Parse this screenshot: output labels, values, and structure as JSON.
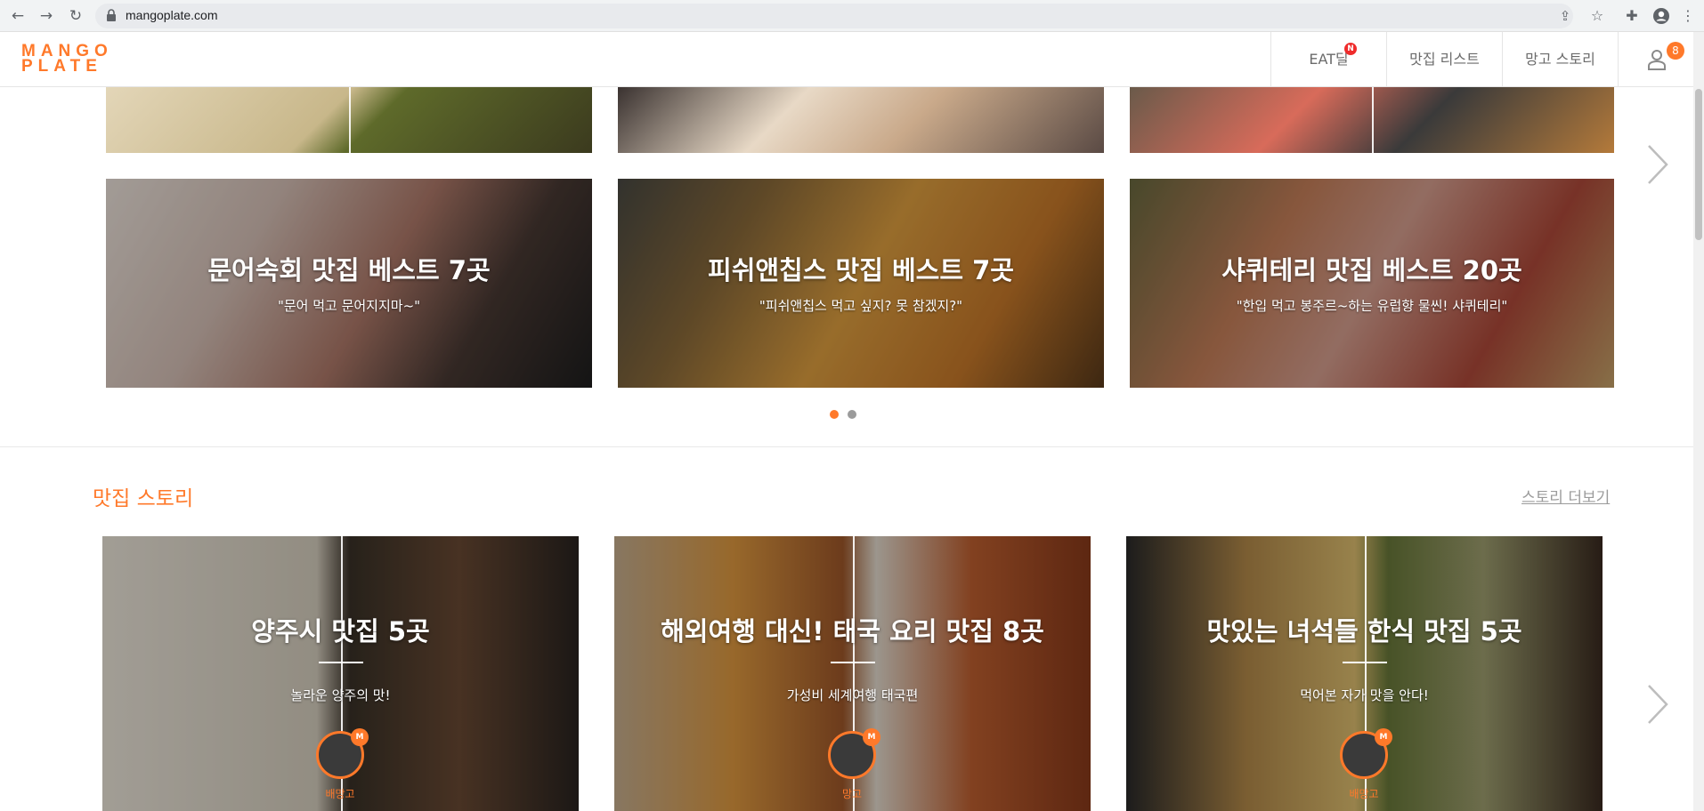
{
  "browser": {
    "url": "mangoplate.com",
    "icons": [
      "back-icon",
      "forward-icon",
      "reload-icon",
      "lock-icon",
      "share-icon",
      "star-icon",
      "extensions-icon",
      "profile-icon",
      "menu-icon"
    ]
  },
  "header": {
    "logo_top": "MANGO",
    "logo_bottom": "PLATE",
    "nav": [
      {
        "label": "EAT딜",
        "badge": "N"
      },
      {
        "label": "맛집 리스트"
      },
      {
        "label": "망고 스토리"
      }
    ],
    "notification_count": "8"
  },
  "top_row": {
    "tiles": [
      {
        "title": "",
        "colors": [
          "#d9c9a8",
          "#7c6a3a"
        ]
      },
      {
        "title": "",
        "colors": [
          "#d4bfa4",
          "#6b5a4a"
        ]
      },
      {
        "title": "",
        "colors": [
          "#c46a5a",
          "#6a4a3a"
        ]
      }
    ]
  },
  "lists": {
    "tiles": [
      {
        "title": "문어숙회 맛집 베스트 7곳",
        "subtitle": "\"문어 먹고 문어지지마~\"",
        "colors": [
          "#e6dcd2",
          "#a8553a"
        ]
      },
      {
        "title": "피쉬앤칩스 맛집 베스트 7곳",
        "subtitle": "\"피쉬앤칩스 먹고 싶지? 못 참겠지?\"",
        "colors": [
          "#d7953a",
          "#7a4a1a"
        ]
      },
      {
        "title": "샤퀴테리 맛집 베스트 20곳",
        "subtitle": "\"한입 먹고 봉주르~하는 유럽향 물씬! 샤퀴테리\"",
        "colors": [
          "#c98a7a",
          "#7a3a2a"
        ]
      }
    ],
    "pager": [
      "active",
      "inactive"
    ]
  },
  "stories": {
    "title": "맛집 스토리",
    "more": "스토리 더보기",
    "cards": [
      {
        "title": "양주시 맛집 5곳",
        "subtitle": "놀라운 양주의 맛!",
        "author": "배망고",
        "colors": [
          "#e8e2d6",
          "#4a3a2a"
        ]
      },
      {
        "title": "해외여행 대신! 태국 요리 맛집 8곳",
        "subtitle": "가성비 세계여행 태국편",
        "author": "망고",
        "colors": [
          "#e0a050",
          "#8a4a2a"
        ]
      },
      {
        "title": "맛있는 녀석들 한식 맛집 5곳",
        "subtitle": "먹어본 자가 맛을 안다!",
        "author": "배망고",
        "colors": [
          "#c8b070",
          "#5a6a3a"
        ]
      }
    ]
  },
  "colors": {
    "brand": "#ff792a",
    "pager_inactive": "#9b9b9b"
  }
}
